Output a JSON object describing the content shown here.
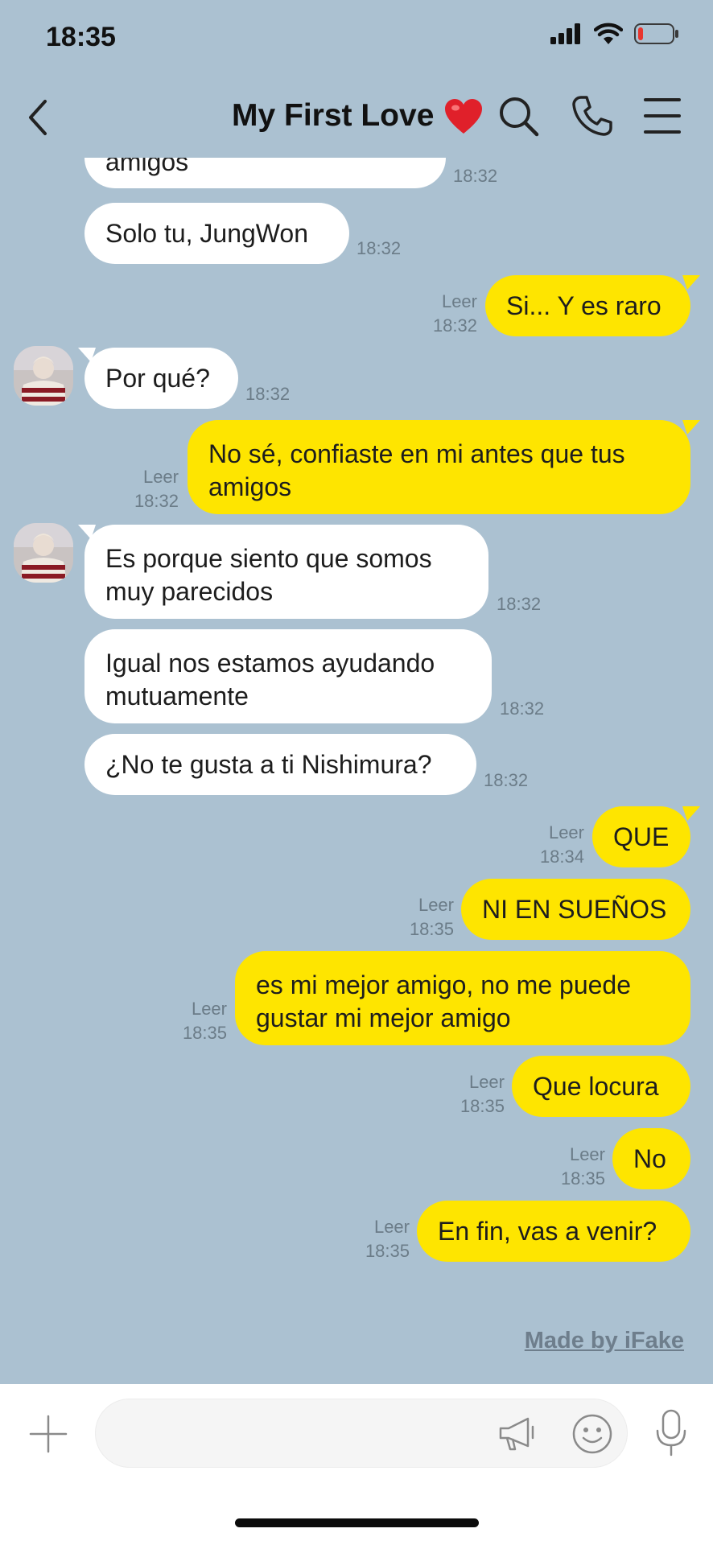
{
  "status": {
    "time": "18:35"
  },
  "header": {
    "title": "My First Love"
  },
  "messages": [
    {
      "side": "in",
      "text": "amigos",
      "time": "18:32"
    },
    {
      "side": "in",
      "text": "Solo tu, JungWon",
      "time": "18:32"
    },
    {
      "side": "out",
      "text": "Si... Y es raro",
      "read": "Leer",
      "time": "18:32"
    },
    {
      "side": "in",
      "text": "Por qué?",
      "time": "18:32"
    },
    {
      "side": "out",
      "line1": "No sé, confiaste en mi antes que tus",
      "line2": "amigos",
      "read": "Leer",
      "time": "18:32"
    },
    {
      "side": "in",
      "line1": "Es porque siento que somos",
      "line2": "muy parecidos",
      "time": "18:32"
    },
    {
      "side": "in",
      "line1": "Igual nos estamos ayudando",
      "line2": "mutuamente",
      "time": "18:32"
    },
    {
      "side": "in",
      "text": "¿No te gusta a ti Nishimura?",
      "time": "18:32"
    },
    {
      "side": "out",
      "text": "QUE",
      "read": "Leer",
      "time": "18:34"
    },
    {
      "side": "out",
      "text": "NI EN SUEÑOS",
      "read": "Leer",
      "time": "18:35"
    },
    {
      "side": "out",
      "line1": "es mi mejor amigo, no me puede",
      "line2": "gustar mi mejor amigo",
      "read": "Leer",
      "time": "18:35"
    },
    {
      "side": "out",
      "text": "Que locura",
      "read": "Leer",
      "time": "18:35"
    },
    {
      "side": "out",
      "text": "No",
      "read": "Leer",
      "time": "18:35"
    },
    {
      "side": "out",
      "text": "En fin, vas a venir?",
      "read": "Leer",
      "time": "18:35"
    }
  ],
  "watermark": "Made by iFake",
  "input": {
    "value": "",
    "placeholder": ""
  },
  "colors": {
    "background": "#abc1d1",
    "outgoing_bubble": "#fee500",
    "incoming_bubble": "#ffffff",
    "battery_low": "#e8362f"
  },
  "icons": [
    "back-icon",
    "heart-icon",
    "search-icon",
    "phone-icon",
    "menu-icon",
    "plus-icon",
    "megaphone-icon",
    "emoji-icon",
    "microphone-icon"
  ]
}
